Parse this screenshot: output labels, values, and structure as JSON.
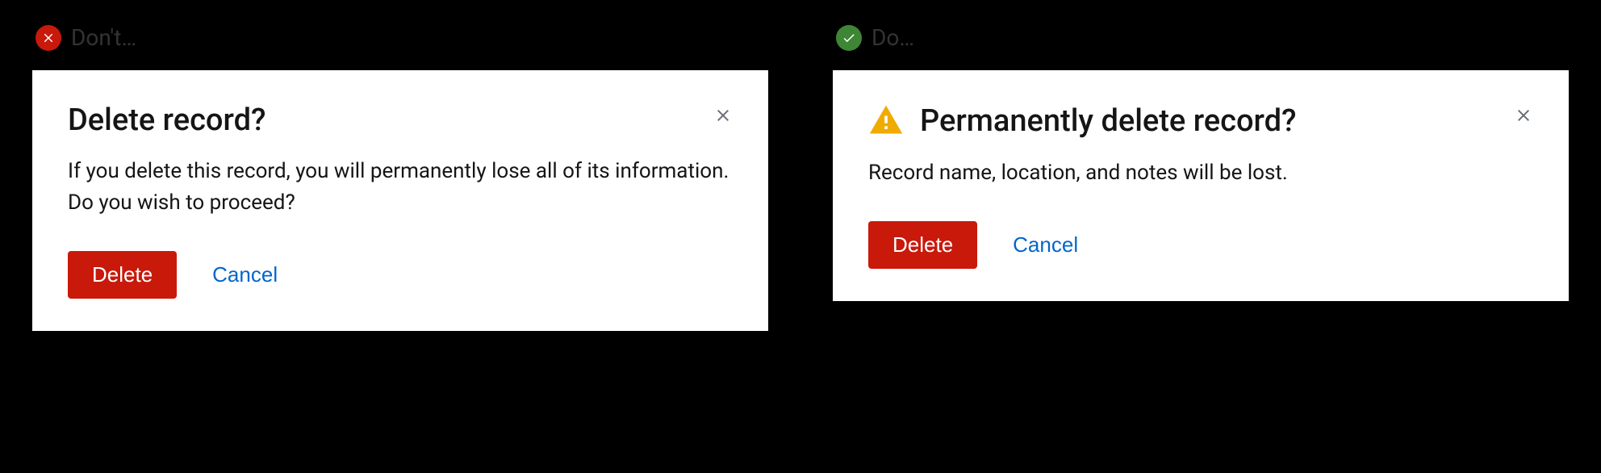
{
  "dont": {
    "label": "Don't…",
    "dialog": {
      "title": "Delete record?",
      "body": "If you delete this record, you will permanently lose all of its information. Do you wish to proceed?",
      "primary_button": "Delete",
      "secondary_button": "Cancel"
    }
  },
  "do": {
    "label": "Do…",
    "dialog": {
      "title": "Permanently delete record?",
      "body": "Record name, location, and notes will be lost.",
      "primary_button": "Delete",
      "secondary_button": "Cancel"
    }
  }
}
